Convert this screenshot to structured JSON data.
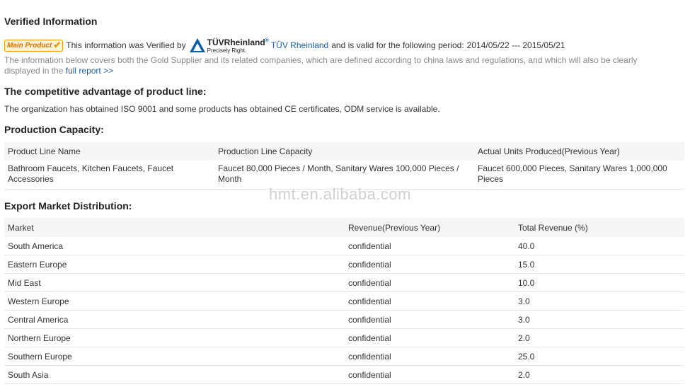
{
  "verified": {
    "heading": "Verified Information",
    "badge_label": "Main Product",
    "text_before": "This information was Verified by",
    "logo_brand": "TÜVRheinland",
    "logo_reg": "®",
    "logo_tagline": "Precisely Right.",
    "link_label": "TÜV Rheinland",
    "text_after": "and is valid for the following period:",
    "period": "2014/05/22 --- 2015/05/21",
    "note_text": "The information below covers both the Gold Supplier and its related companies, which are defined according to china laws and regulations, and which will also be clearly displayed in the",
    "report_link": "full report >>"
  },
  "advantage": {
    "heading": "The competitive advantage of product line:",
    "text": "The organization has obtained ISO 9001 and some products has obtained CE certificates, ODM service is available."
  },
  "production": {
    "heading": "Production Capacity:",
    "columns": [
      "Product Line Name",
      "Production Line Capacity",
      "Actual Units Produced(Previous Year)"
    ],
    "rows": [
      [
        "Bathroom Faucets, Kitchen Faucets, Faucet Accessories",
        "Faucet 80,000 Pieces / Month, Sanitary Wares 100,000 Pieces / Month",
        "Faucet 600,000 Pieces, Sanitary Wares 1,000,000 Pieces"
      ]
    ]
  },
  "export": {
    "heading": "Export Market Distribution:",
    "columns": [
      "Market",
      "Revenue(Previous Year)",
      "Total Revenue (%)"
    ],
    "rows": [
      [
        "South America",
        "confidential",
        "40.0"
      ],
      [
        "Eastern Europe",
        "confidential",
        "15.0"
      ],
      [
        "Mid East",
        "confidential",
        "10.0"
      ],
      [
        "Western Europe",
        "confidential",
        "3.0"
      ],
      [
        "Central America",
        "confidential",
        "3.0"
      ],
      [
        "Northern Europe",
        "confidential",
        "2.0"
      ],
      [
        "Southern Europe",
        "confidential",
        "25.0"
      ],
      [
        "South Asia",
        "confidential",
        "2.0"
      ]
    ]
  },
  "watermark": "hmt.en.alibaba.com",
  "colors": {
    "link": "#1a5fa8",
    "badge": "#f39800",
    "muted": "#888888",
    "header_bg": "#f5f5f5"
  }
}
